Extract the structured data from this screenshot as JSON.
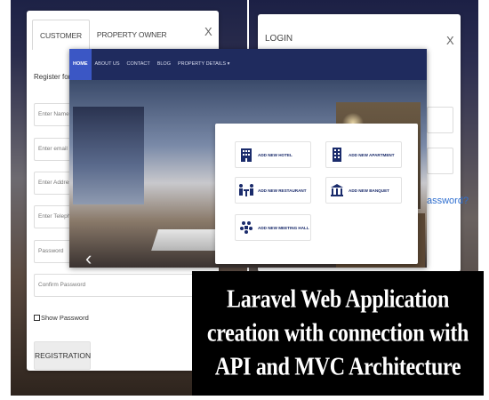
{
  "registration_modal": {
    "tabs": [
      {
        "label": "CUSTOMER"
      },
      {
        "label": "PROPERTY OWNER"
      }
    ],
    "close_label": "X",
    "subtitle": "Register for Yo",
    "fields": [
      {
        "placeholder": "Enter Name"
      },
      {
        "placeholder": "Enter email"
      },
      {
        "placeholder": "Enter Address"
      },
      {
        "placeholder": "Enter Telephone"
      },
      {
        "placeholder": "Password"
      },
      {
        "placeholder": "Confirm Password"
      }
    ],
    "show_password_label": "Show Password",
    "register_button": "REGISTRATION"
  },
  "login_modal": {
    "title": "LOGIN",
    "close_label": "X",
    "forgot_link": "assword?"
  },
  "website": {
    "nav": [
      {
        "label": "HOME"
      },
      {
        "label": "ABOUT US"
      },
      {
        "label": "CONTACT"
      },
      {
        "label": "BLOG"
      },
      {
        "label": "PROPERTY DETAILS ▾"
      }
    ],
    "carousel_prev": "‹",
    "dropdown": [
      {
        "label": "ADD NEW HOTEL",
        "icon": "hotel-icon"
      },
      {
        "label": "ADD NEW APARTMENT",
        "icon": "apartment-icon"
      },
      {
        "label": "ADD NEW RESTAURANT",
        "icon": "restaurant-icon"
      },
      {
        "label": "ADD NEW BANQUET",
        "icon": "banquet-icon"
      },
      {
        "label": "ADD NEW MEETING HALL",
        "icon": "meeting-hall-icon"
      }
    ]
  },
  "caption": {
    "lines": [
      "Laravel Web Application",
      "creation with connection with",
      "API and MVC Architecture"
    ]
  },
  "colors": {
    "nav_bg": "#1f2b5e",
    "nav_active": "#3b57c5",
    "icon_blue": "#1a2b6b",
    "link_blue": "#2f6fd0"
  }
}
